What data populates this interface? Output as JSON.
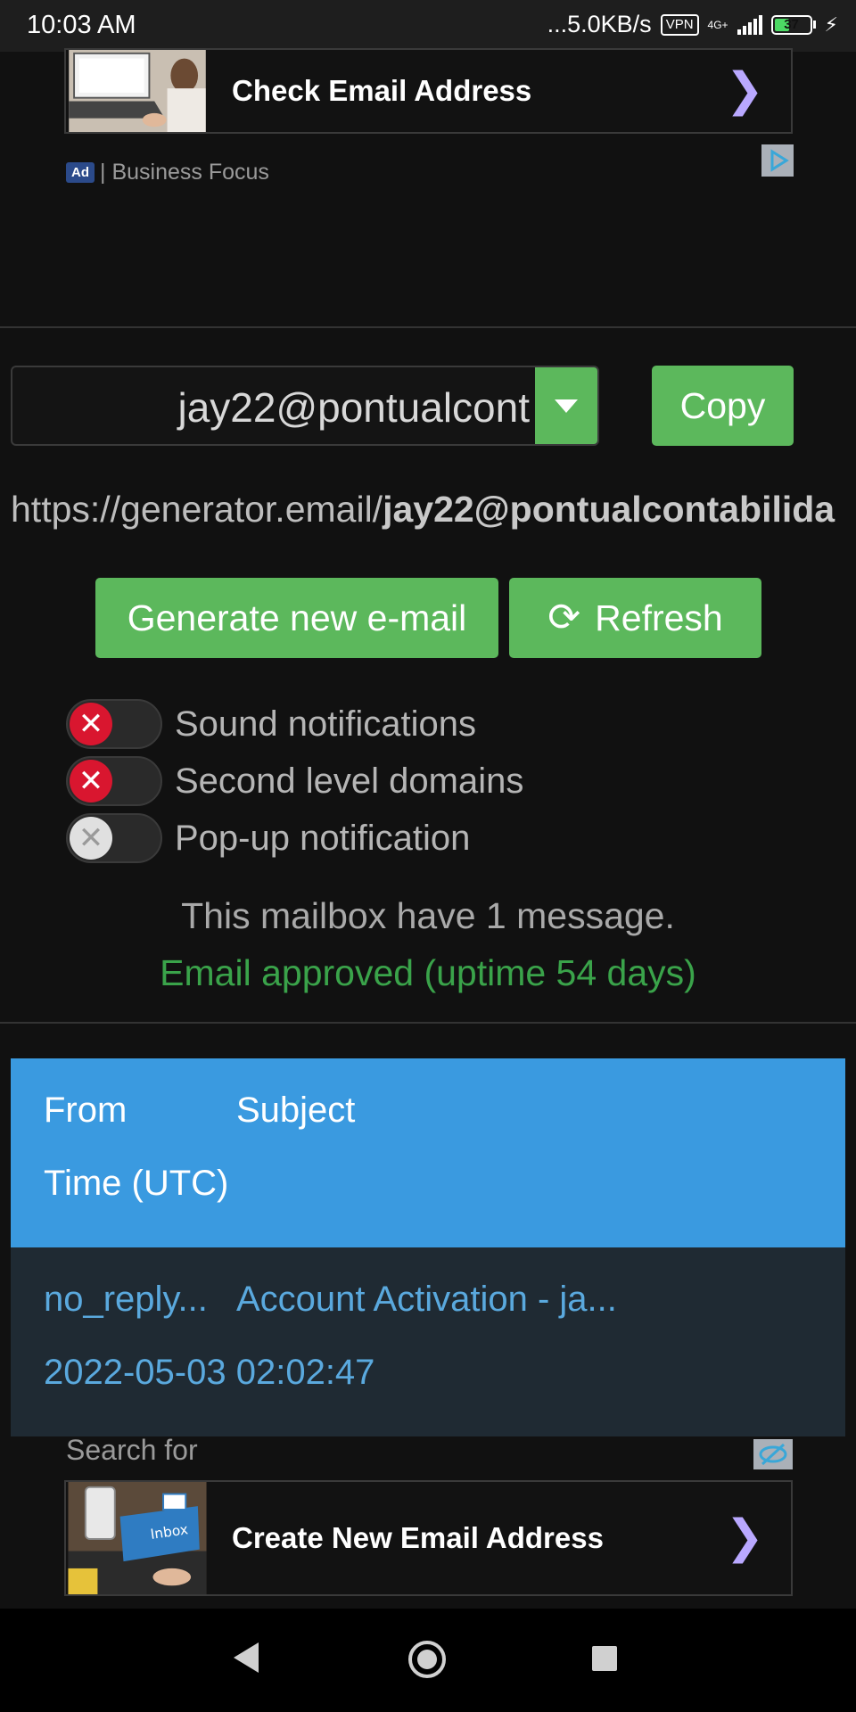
{
  "status_bar": {
    "time": "10:03 AM",
    "net_speed": "...5.0KB/s",
    "vpn": "VPN",
    "network": "4G+",
    "battery": "37",
    "battery_level": 0.37
  },
  "top_ad": {
    "title": "Check Email Address",
    "chevron": "❯",
    "ad_badge": "Ad",
    "sponsor": "| Business Focus",
    "adchoices_icon": "adchoices-icon"
  },
  "mailbox": {
    "email": "jay22@pontualcont",
    "copy_label": "Copy",
    "url_prefix": "https://generator.email/",
    "url_bold": "jay22@pontualcontabilida",
    "generate_label": "Generate new e-mail",
    "refresh_icon": "⟳",
    "refresh_label": "Refresh"
  },
  "toggles": [
    {
      "label": "Sound notifications",
      "state": "off-red",
      "knob": "✕"
    },
    {
      "label": "Second level domains",
      "state": "off-red",
      "knob": "✕"
    },
    {
      "label": "Pop-up notification",
      "state": "off-grey",
      "knob": "✕"
    }
  ],
  "status": {
    "message_count": "This mailbox have 1 message.",
    "approved": "Email approved (uptime 54 days)"
  },
  "table": {
    "headers": {
      "from": "From",
      "subject": "Subject",
      "time": "Time (UTC)"
    },
    "rows": [
      {
        "from": "no_reply...",
        "subject": "Account Activation - ja...",
        "time": "2022-05-03 02:02:47"
      }
    ]
  },
  "bottom_ad": {
    "search_for": "Search for",
    "title": "Create New Email Address",
    "chevron": "❯",
    "thumb_text": "Inbox"
  },
  "colors": {
    "accent_green": "#5cb85c",
    "header_blue": "#3a9ae0",
    "approved_green": "#3aa34a",
    "toggle_red": "#d9162f"
  }
}
